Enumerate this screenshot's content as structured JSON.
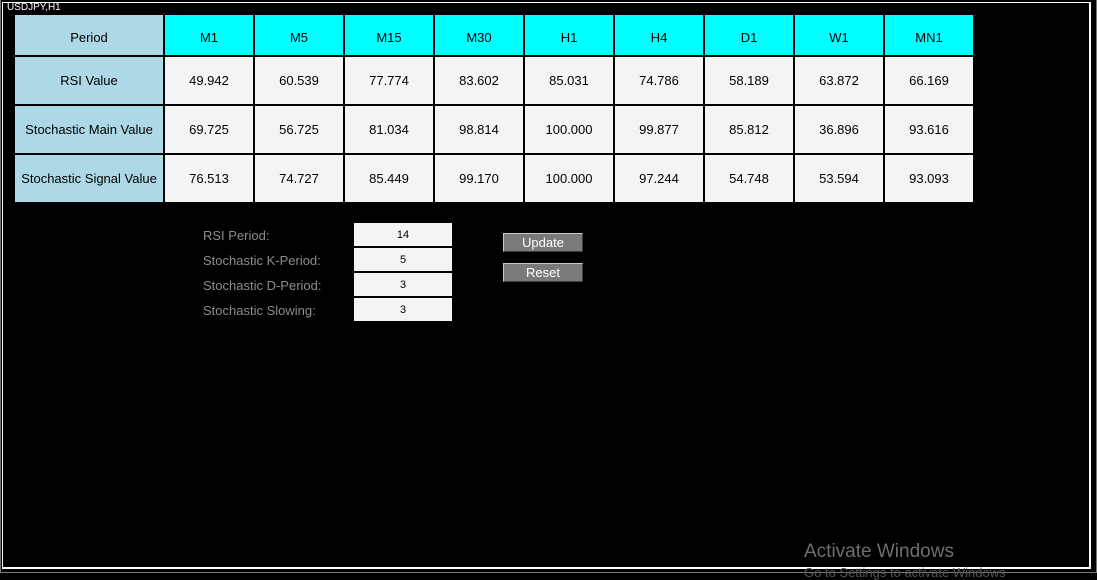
{
  "window": {
    "title": "USDJPY,H1"
  },
  "table": {
    "corner": "Period",
    "columns": [
      "M1",
      "M5",
      "M15",
      "M30",
      "H1",
      "H4",
      "D1",
      "W1",
      "MN1"
    ],
    "rows": [
      {
        "label": "RSI Value",
        "values": [
          "49.942",
          "60.539",
          "77.774",
          "83.602",
          "85.031",
          "74.786",
          "58.189",
          "63.872",
          "66.169"
        ]
      },
      {
        "label": "Stochastic Main Value",
        "values": [
          "69.725",
          "56.725",
          "81.034",
          "98.814",
          "100.000",
          "99.877",
          "85.812",
          "36.896",
          "93.616"
        ]
      },
      {
        "label": "Stochastic Signal Value",
        "values": [
          "76.513",
          "74.727",
          "85.449",
          "99.170",
          "100.000",
          "97.244",
          "54.748",
          "53.594",
          "93.093"
        ]
      }
    ]
  },
  "settings": [
    {
      "label": "RSI Period:",
      "value": "14"
    },
    {
      "label": "Stochastic K-Period:",
      "value": "5"
    },
    {
      "label": "Stochastic D-Period:",
      "value": "3"
    },
    {
      "label": "Stochastic Slowing:",
      "value": "3"
    }
  ],
  "buttons": {
    "update": "Update",
    "reset": "Reset"
  },
  "watermark": {
    "line1": "Activate Windows",
    "line2": "Go to Settings to activate Windows"
  }
}
